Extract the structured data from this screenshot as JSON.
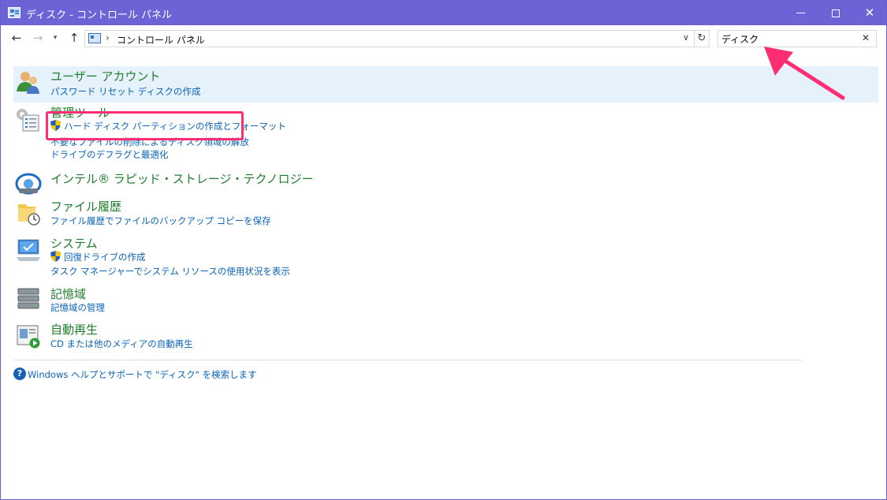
{
  "window": {
    "title": "ディスク - コントロール パネル",
    "buttons": [
      "minimize",
      "maximize",
      "close"
    ]
  },
  "navigation": {
    "back_icon": "arrow-left-icon",
    "forward_icon": "arrow-right-icon",
    "recent_icon": "chevron-down-icon",
    "up_icon": "arrow-up-icon",
    "address": {
      "icon": "control-panel-icon",
      "breadcrumb": "コントロール パネル",
      "separator": "›"
    },
    "refresh_icon": "refresh-icon",
    "search": {
      "value": "ディスク",
      "clear_icon": "close-icon"
    }
  },
  "results": [
    {
      "title": "ユーザー アカウント",
      "icon": "users-icon",
      "highlighted": true,
      "links": [
        {
          "label": "パスワード リセット ディスクの作成",
          "shield": false
        }
      ]
    },
    {
      "title": "管理ツール",
      "icon": "admin-tools-icon",
      "links": [
        {
          "label": "ハード ディスク パーティションの作成とフォーマット",
          "shield": true
        },
        {
          "label": "不要なファイルの削除によるディスク領域の解放",
          "shield": false
        },
        {
          "label": "ドライブのデフラグと最適化",
          "shield": false
        }
      ]
    },
    {
      "title": "インテル® ラピッド・ストレージ・テクノロジー",
      "icon": "intel-rst-icon",
      "links": []
    },
    {
      "title": "ファイル履歴",
      "icon": "file-history-icon",
      "links": [
        {
          "label": "ファイル履歴でファイルのバックアップ コピーを保存",
          "shield": false
        }
      ]
    },
    {
      "title": "システム",
      "icon": "system-icon",
      "links": [
        {
          "label": "回復ドライブの作成",
          "shield": true
        },
        {
          "label": "タスク マネージャーでシステム リソースの使用状況を表示",
          "shield": false
        }
      ]
    },
    {
      "title": "記憶域",
      "icon": "storage-spaces-icon",
      "links": [
        {
          "label": "記憶域の管理",
          "shield": false
        }
      ]
    },
    {
      "title": "自動再生",
      "icon": "autoplay-icon",
      "links": [
        {
          "label": "CD または他のメディアの自動再生",
          "shield": false
        }
      ]
    }
  ],
  "help": {
    "icon": "help-icon",
    "text": "Windows ヘルプとサポートで \"ディスク\" を検索します"
  },
  "colors": {
    "titlebar": "#6c63d7",
    "category_title": "#1e7d2b",
    "link": "#0a63b8",
    "row_highlight": "#e5f1fb",
    "annotation": "#ff2d74"
  },
  "annotations": {
    "highlight_box": "red-highlight-rectangle",
    "arrow": "pink-arrow-pointing-to-search"
  }
}
